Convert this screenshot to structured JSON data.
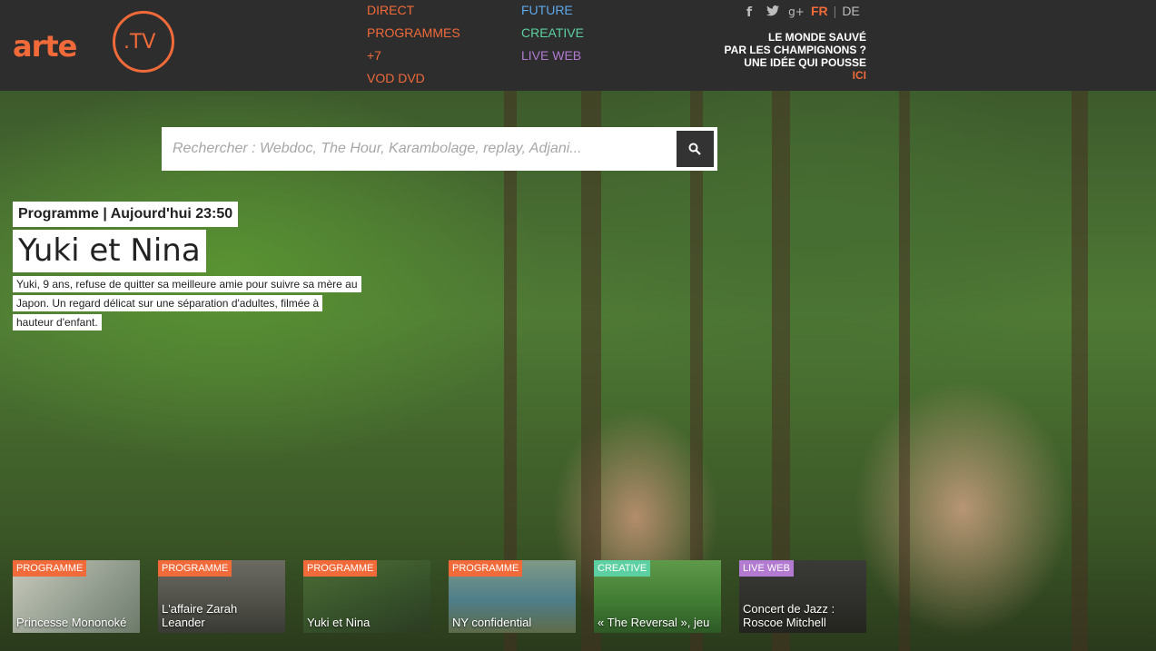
{
  "logo": {
    "brand": "arte",
    "suffix": ".TV"
  },
  "nav": {
    "col1": [
      "DIRECT",
      "PROGRAMMES",
      "+7",
      "VOD DVD"
    ],
    "col2": [
      "FUTURE",
      "CREATIVE",
      "LIVE WEB"
    ]
  },
  "social": {
    "facebook": "f",
    "twitter": "t",
    "googleplus": "g+"
  },
  "lang": {
    "fr": "FR",
    "sep": "|",
    "de": "DE"
  },
  "promo": {
    "line1": "LE MONDE SAUVÉ",
    "line2": "PAR LES CHAMPIGNONS ?",
    "line3": "UNE IDÉE QUI POUSSE",
    "link": "ICI"
  },
  "search": {
    "placeholder": "Rechercher : Webdoc, The Hour, Karambolage, replay, Adjani..."
  },
  "featured": {
    "label": "Programme | Aujourd'hui 23:50",
    "title": "Yuki et Nina",
    "description": "Yuki, 9 ans, refuse de quitter sa meilleure amie pour suivre sa mère au Japon. Un regard délicat sur une séparation d'adultes, filmée à hauteur d'enfant."
  },
  "cards": [
    {
      "tag": "PROGRAMME",
      "title": "Princesse Mononoké",
      "tag_color": "#f06a3a"
    },
    {
      "tag": "PROGRAMME",
      "title": "L'affaire Zarah Leander",
      "tag_color": "#f06a3a"
    },
    {
      "tag": "PROGRAMME",
      "title": "Yuki et Nina",
      "tag_color": "#f06a3a"
    },
    {
      "tag": "PROGRAMME",
      "title": "NY confidential",
      "tag_color": "#f06a3a"
    },
    {
      "tag": "CREATIVE",
      "title": "« The Reversal », jeu",
      "tag_color": "#5cd0a0"
    },
    {
      "tag": "LIVE WEB",
      "title": "Concert de Jazz : Roscoe Mitchell",
      "tag_color": "#b27ad0"
    }
  ],
  "colors": {
    "accent": "#f06a3a",
    "future": "#5fa8e8",
    "creative": "#5cd0a0",
    "liveweb": "#b27ad0",
    "header_bg": "#2d2d2d"
  }
}
